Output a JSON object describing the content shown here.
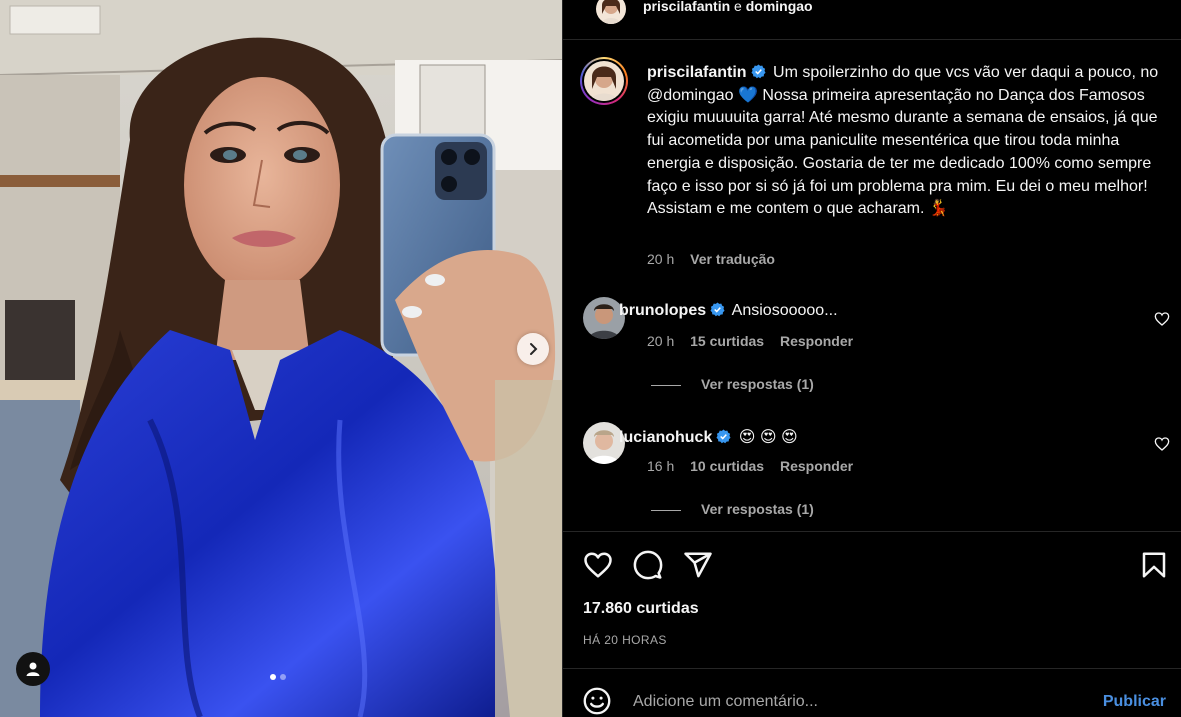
{
  "header": {
    "author": "priscilafantin",
    "conjunction": "e",
    "coauthor": "domingao"
  },
  "caption": {
    "username": "priscilafantin",
    "text": "Um spoilerzinho do que vcs vão ver daqui a pouco, no @domingao 💙 Nossa primeira apresentação no Dança dos Famosos exigiu muuuuita garra! Até mesmo durante a semana de ensaios, já que fui acometida por uma paniculite mesentérica que tirou toda minha energia e disposição. Gostaria de ter me dedicado 100% como sempre faço e isso por si só já foi um problema pra mim. Eu dei o meu melhor! Assistam e me contem o que acharam. 💃",
    "age": "20 h",
    "translate": "Ver tradução"
  },
  "comments": [
    {
      "username": "brunolopes",
      "text": "Ansiosooooo...",
      "age": "20 h",
      "likes": "15 curtidas",
      "reply": "Responder",
      "replies": "Ver respostas (1)"
    },
    {
      "username": "lucianohuck",
      "text": "😍 😍 😍",
      "age": "16 h",
      "likes": "10 curtidas",
      "reply": "Responder",
      "replies": "Ver respostas (1)"
    }
  ],
  "post": {
    "likes": "17.860 curtidas",
    "posted": "HÁ 20 HORAS"
  },
  "composer": {
    "placeholder": "Adicione um comentário...",
    "publish": "Publicar"
  },
  "carousel": {
    "slides": 2,
    "active": 1
  },
  "icons": {
    "verified": "verified-badge-icon",
    "like": "heart-icon",
    "comment": "comment-icon",
    "share": "send-icon",
    "save": "bookmark-icon",
    "emoji": "emoji-icon",
    "next": "chevron-right-icon",
    "tags": "user-tag-icon"
  },
  "colors": {
    "background": "#000000",
    "text": "#f5f5f5",
    "muted": "#a8a8a8",
    "link": "#4a8fe0",
    "verified": "#3897f0",
    "divider": "#262626"
  }
}
